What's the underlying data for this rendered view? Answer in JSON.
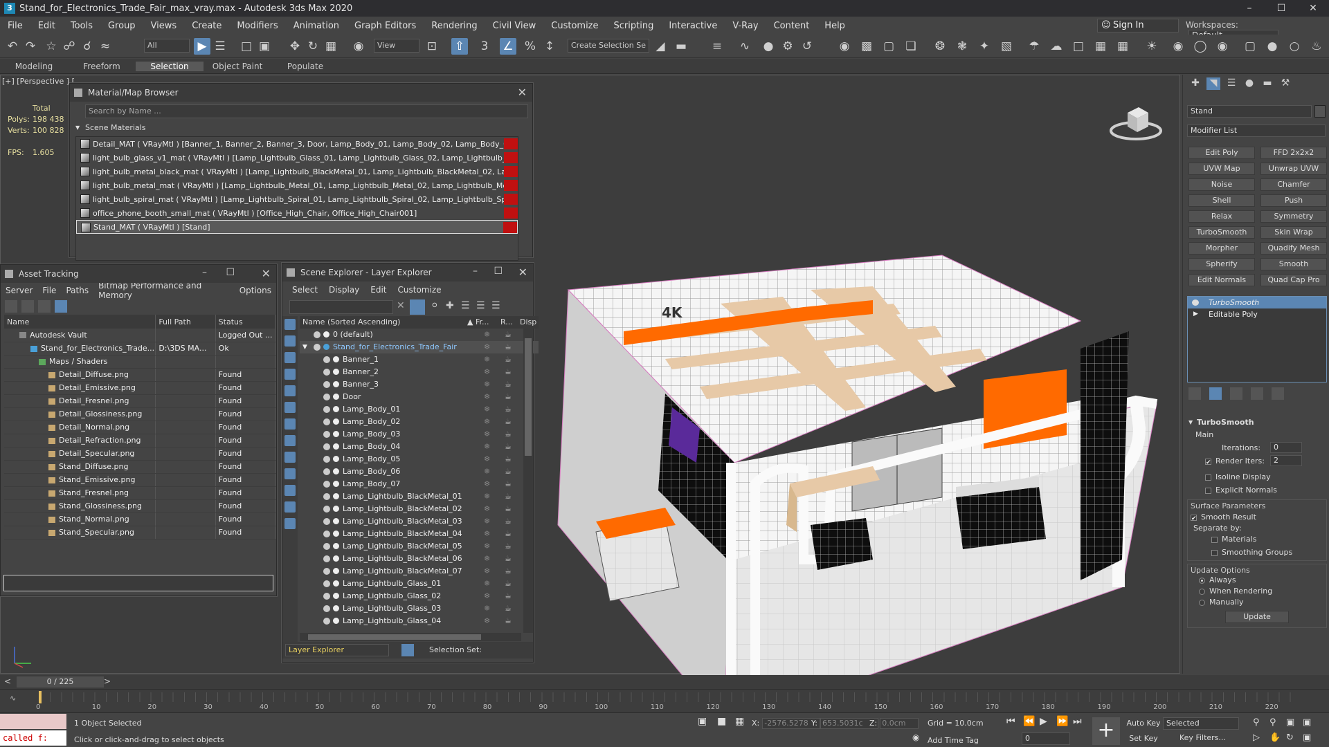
{
  "window": {
    "title": "Stand_for_Electronics_Trade_Fair_max_vray.max - Autodesk 3ds Max 2020",
    "app_icon": "3"
  },
  "menu": [
    "File",
    "Edit",
    "Tools",
    "Group",
    "Views",
    "Create",
    "Modifiers",
    "Animation",
    "Graph Editors",
    "Rendering",
    "Civil View",
    "Customize",
    "Scripting",
    "Interactive",
    "V-Ray",
    "Content",
    "Help"
  ],
  "signin": "Sign In",
  "workspaces": {
    "label": "Workspaces:",
    "value": "Default"
  },
  "toolbar": {
    "filter": "All",
    "view": "View",
    "selection_set": "Create Selection Se"
  },
  "ribbon": [
    "Modeling",
    "Freeform",
    "Selection",
    "Object Paint",
    "Populate"
  ],
  "ribbon_active": "Selection",
  "viewport": {
    "label": "[+] [Perspective ] [",
    "stats": {
      "total_label": "Total",
      "polys_label": "Polys:",
      "polys": "198 438",
      "verts_label": "Verts:",
      "verts": "100 828",
      "fps_label": "FPS:",
      "fps": "1.605"
    },
    "sign_text": "4K"
  },
  "material_browser": {
    "title": "Material/Map Browser",
    "search_placeholder": "Search by Name ...",
    "section": "Scene Materials",
    "items": [
      "Detail_MAT ( VRayMtl ) [Banner_1, Banner_2, Banner_3, Door, Lamp_Body_01, Lamp_Body_02, Lamp_Body_03, Lam...",
      "light_bulb_glass_v1_mat ( VRayMtl ) [Lamp_Lightbulb_Glass_01, Lamp_Lightbulb_Glass_02, Lamp_Lightbulb_Glass_0...",
      "light_bulb_metal_black_mat ( VRayMtl ) [Lamp_Lightbulb_BlackMetal_01, Lamp_Lightbulb_BlackMetal_02, Lamp_Light...",
      "light_bulb_metal_mat ( VRayMtl ) [Lamp_Lightbulb_Metal_01, Lamp_Lightbulb_Metal_02, Lamp_Lightbulb_Metal_03,...",
      "light_bulb_spiral_mat ( VRayMtl ) [Lamp_Lightbulb_Spiral_01, Lamp_Lightbulb_Spiral_02, Lamp_Lightbulb_Spiral_03,...",
      "office_phone_booth_small_mat ( VRayMtl ) [Office_High_Chair, Office_High_Chair001]",
      "Stand_MAT ( VRayMtl ) [Stand]"
    ]
  },
  "asset_tracking": {
    "title": "Asset Tracking",
    "menu": [
      "Server",
      "File",
      "Paths",
      "Bitmap Performance and Memory",
      "Options"
    ],
    "columns": [
      "Name",
      "Full Path",
      "Status"
    ],
    "rows": [
      {
        "name": "Autodesk Vault",
        "path": "",
        "status": "Logged Out ..."
      },
      {
        "name": "Stand_for_Electronics_Trade...",
        "path": "D:\\3DS MA...",
        "status": "Ok"
      },
      {
        "name": "Maps / Shaders",
        "path": "",
        "status": ""
      },
      {
        "name": "Detail_Diffuse.png",
        "path": "",
        "status": "Found"
      },
      {
        "name": "Detail_Emissive.png",
        "path": "",
        "status": "Found"
      },
      {
        "name": "Detail_Fresnel.png",
        "path": "",
        "status": "Found"
      },
      {
        "name": "Detail_Glossiness.png",
        "path": "",
        "status": "Found"
      },
      {
        "name": "Detail_Normal.png",
        "path": "",
        "status": "Found"
      },
      {
        "name": "Detail_Refraction.png",
        "path": "",
        "status": "Found"
      },
      {
        "name": "Detail_Specular.png",
        "path": "",
        "status": "Found"
      },
      {
        "name": "Stand_Diffuse.png",
        "path": "",
        "status": "Found"
      },
      {
        "name": "Stand_Emissive.png",
        "path": "",
        "status": "Found"
      },
      {
        "name": "Stand_Fresnel.png",
        "path": "",
        "status": "Found"
      },
      {
        "name": "Stand_Glossiness.png",
        "path": "",
        "status": "Found"
      },
      {
        "name": "Stand_Normal.png",
        "path": "",
        "status": "Found"
      },
      {
        "name": "Stand_Specular.png",
        "path": "",
        "status": "Found"
      }
    ]
  },
  "scene_explorer": {
    "title": "Scene Explorer - Layer Explorer",
    "menu": [
      "Select",
      "Display",
      "Edit",
      "Customize"
    ],
    "col_name": "Name (Sorted Ascending)",
    "col_fr": "▲ Fr...",
    "col_r": "R...",
    "col_disp": "Disp",
    "rows": [
      "0 (default)",
      "Stand_for_Electronics_Trade_Fair",
      "Banner_1",
      "Banner_2",
      "Banner_3",
      "Door",
      "Lamp_Body_01",
      "Lamp_Body_02",
      "Lamp_Body_03",
      "Lamp_Body_04",
      "Lamp_Body_05",
      "Lamp_Body_06",
      "Lamp_Body_07",
      "Lamp_Lightbulb_BlackMetal_01",
      "Lamp_Lightbulb_BlackMetal_02",
      "Lamp_Lightbulb_BlackMetal_03",
      "Lamp_Lightbulb_BlackMetal_04",
      "Lamp_Lightbulb_BlackMetal_05",
      "Lamp_Lightbulb_BlackMetal_06",
      "Lamp_Lightbulb_BlackMetal_07",
      "Lamp_Lightbulb_Glass_01",
      "Lamp_Lightbulb_Glass_02",
      "Lamp_Lightbulb_Glass_03",
      "Lamp_Lightbulb_Glass_04"
    ],
    "footer_explorer": "Layer Explorer",
    "footer_selset": "Selection Set:"
  },
  "command_panel": {
    "object_name": "Stand",
    "modifier_list": "Modifier List",
    "modifiers": [
      "Edit Poly",
      "FFD 2x2x2",
      "UVW Map",
      "Unwrap UVW",
      "Noise",
      "Chamfer",
      "Shell",
      "Push",
      "Relax",
      "Symmetry",
      "TurboSmooth",
      "Skin Wrap",
      "Morpher",
      "Quadify Mesh",
      "Spherify",
      "Smooth",
      "Edit Normals",
      "Quad Cap Pro"
    ],
    "stack": [
      "TurboSmooth",
      "Editable Poly"
    ],
    "turbosmooth": {
      "title": "TurboSmooth",
      "main": "Main",
      "iterations_label": "Iterations:",
      "iterations": "0",
      "render_iters_label": "Render Iters:",
      "render_iters": "2",
      "isoline": "Isoline Display",
      "explicit": "Explicit Normals",
      "surface": "Surface Parameters",
      "smooth_result": "Smooth Result",
      "separate_by": "Separate by:",
      "materials": "Materials",
      "smoothing_groups": "Smoothing Groups",
      "update_options": "Update Options",
      "always": "Always",
      "when_rendering": "When Rendering",
      "manually": "Manually",
      "update": "Update"
    }
  },
  "timeline": {
    "slider": "0 / 225",
    "ticks": [
      "0",
      "10",
      "20",
      "30",
      "40",
      "50",
      "60",
      "70",
      "80",
      "90",
      "100",
      "110",
      "120",
      "130",
      "140",
      "150",
      "160",
      "170",
      "180",
      "190",
      "200",
      "210",
      "220"
    ]
  },
  "status": {
    "maxscript": "called f:",
    "selected": "1 Object Selected",
    "prompt": "Click or click-and-drag to select objects",
    "x_label": "X:",
    "x": "-2576.5278",
    "y_label": "Y:",
    "y": "653.5031c",
    "z_label": "Z:",
    "z": "0.0cm",
    "grid": "Grid = 10.0cm",
    "add_time_tag": "Add Time Tag",
    "auto_key": "Auto Key",
    "set_key": "Set Key",
    "selected_dd": "Selected",
    "key_filters": "Key Filters...",
    "frame": "0"
  }
}
